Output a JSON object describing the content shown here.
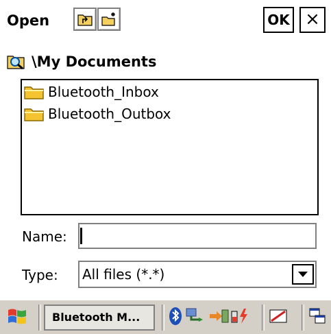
{
  "dialog": {
    "title": "Open",
    "ok_label": "OK",
    "close_label": "×"
  },
  "path": "\\My Documents",
  "files": [
    {
      "name": "Bluetooth_Inbox",
      "icon": "folder-icon"
    },
    {
      "name": "Bluetooth_Outbox",
      "icon": "folder-icon"
    }
  ],
  "name_field": {
    "label": "Name:",
    "value": ""
  },
  "type_field": {
    "label": "Type:",
    "value": "All files (*.*)"
  },
  "taskbar": {
    "task_label": "Bluetooth M...",
    "tray_icons": [
      "bluetooth-icon",
      "network-icon",
      "sync-icon",
      "battery-icon",
      "input-panel-icon",
      "switch-window-icon"
    ]
  },
  "colors": {
    "folder": "#f4c430",
    "taskbar": "#d4d0c8",
    "start_flag_red": "#e33b2e",
    "start_flag_green": "#3aa53a",
    "start_flag_blue": "#2f6ed8",
    "start_flag_yellow": "#f3c51a"
  }
}
